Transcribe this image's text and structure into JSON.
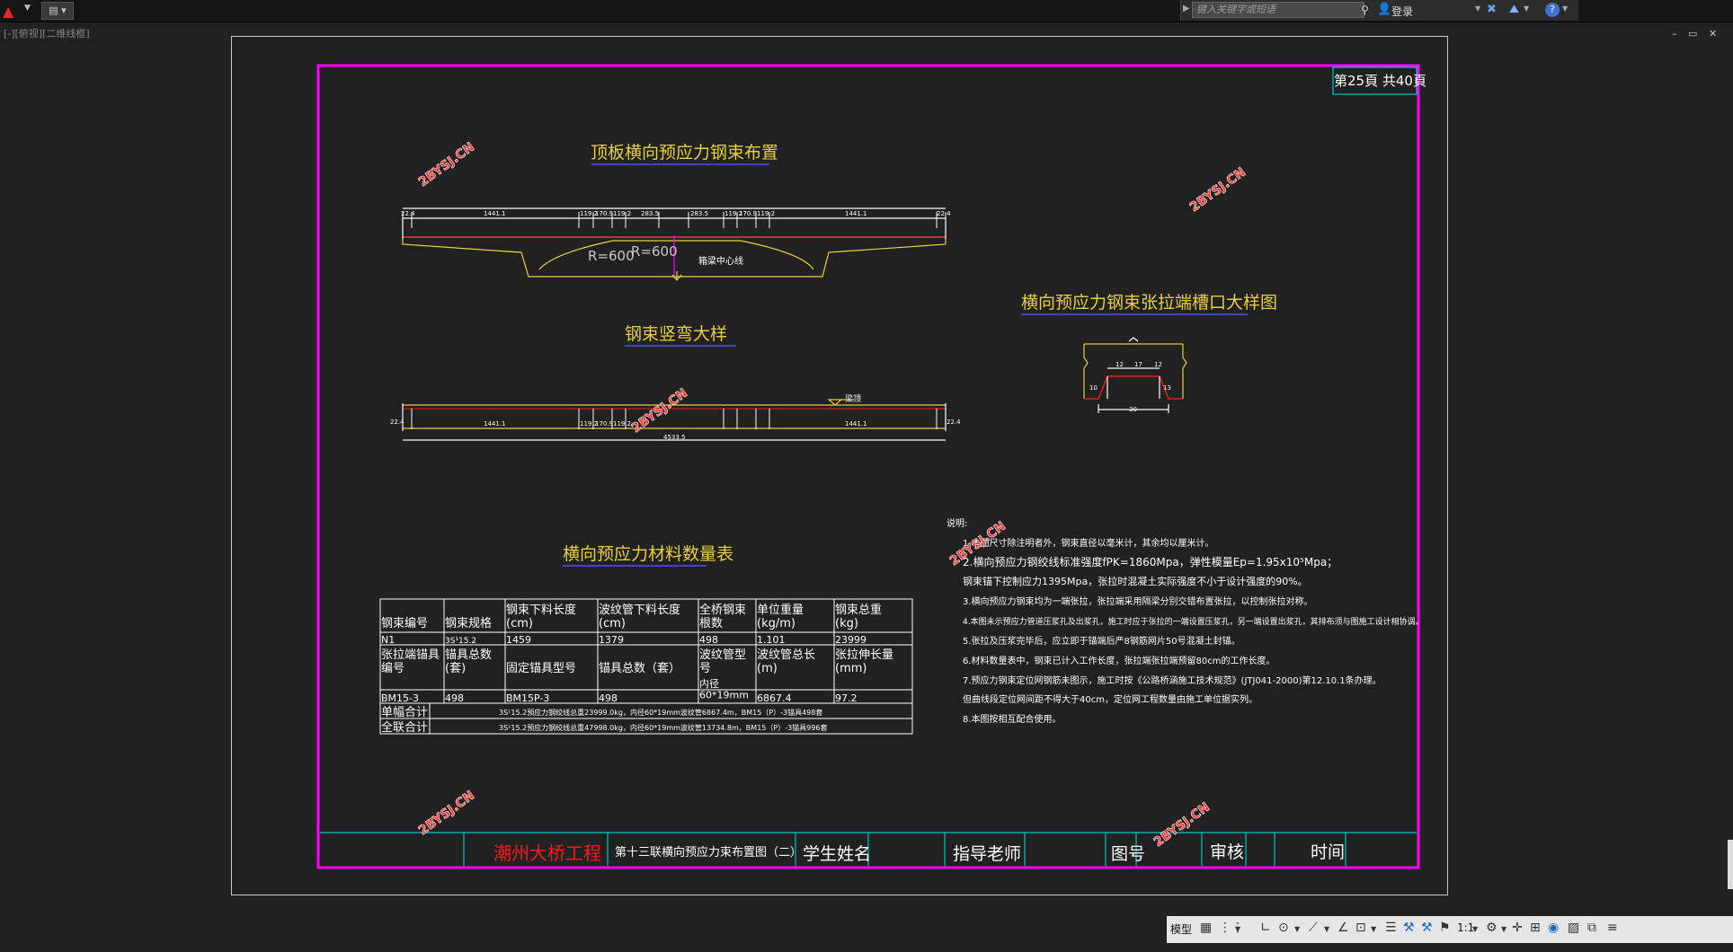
{
  "topbar": {
    "search_placeholder": "键入关键字或短语",
    "login_label": "登录",
    "help_glyph": "?"
  },
  "viewport_label": "[-][俯视][二维线框]",
  "window_controls": [
    "–",
    "▭",
    "✕"
  ],
  "drawing": {
    "page_info": "第25頁  共40頁",
    "watermark": "2BYSJ.CN",
    "title_deck": "顶板横向预应力钢束布置",
    "title_bend": "钢束竖弯大样",
    "title_slot": "横向预应力钢束张拉端槽口大样图",
    "title_table": "横向预应力材料数量表",
    "deck_dims": [
      "22.4",
      "1441.1",
      "119.2",
      "170.9",
      "119.2",
      "283.5",
      "283.5",
      "119.2",
      "170.9",
      "119.2",
      "1441.1",
      "22.4"
    ],
    "deck_radius_left": "R=600",
    "deck_radius_right": "R=600",
    "deck_centerline": "箱梁中心线",
    "bend_dims": [
      "22.4",
      "1441.1",
      "119.2",
      "170.9",
      "119.2",
      "1441.1",
      "22.4"
    ],
    "bend_total": "4533.5",
    "bend_top_label": "梁顶",
    "slot_dims": [
      "12",
      "17",
      "12",
      "10",
      "13",
      "30"
    ],
    "notes_title": "说明:",
    "notes": [
      "1.本图尺寸除注明者外，钢束直径以毫米计，其余均以厘米计。",
      "2.横向预应力钢绞线标准强度fPK=1860Mpa，弹性模量Ep=1.95x10⁵Mpa；",
      "   钢束锚下控制应力1395Mpa，张拉时混凝土实际强度不小于设计强度的90%。",
      "3.横向预应力钢束均为一端张拉，张拉端采用隔梁分别交错布置张拉，以控制张拉对称。",
      "4.本图未示预应力管道压浆孔及出浆孔，施工时应于张拉的一端设置压浆孔，另一端设置出浆孔，其排布须与图施工设计相协调。",
      "5.张拉及压浆完毕后，应立即于锚端后严8钢筋网片50号混凝土封锚。",
      "6.材料数量表中，钢束已计入工作长度，张拉端张拉端预留80cm的工作长度。",
      "7.预应力钢束定位网钢筋未图示，施工时按《公路桥涵施工技术规范》(JTJ041-2000)第12.10.1条办理。",
      "   但曲线段定位网间距不得大于40cm，定位网工程数量由施工单位据实列。",
      "8.本图按相互配合使用。"
    ],
    "table": {
      "header1": [
        "钢束编号",
        "钢束规格",
        "钢束下料长度\n(cm)",
        "波纹管下料长度\n(cm)",
        "全桥钢束\n根数",
        "单位重量\n(kg/m)",
        "钢束总重\n(kg)"
      ],
      "row1": [
        "N1",
        "3S¹15.2",
        "1459",
        "1379",
        "498",
        "1.101",
        "23999"
      ],
      "header2": [
        "张拉端锚具\n编号",
        "锚具总数\n(套)",
        "固定锚具型号",
        "锚具总数（套）",
        "波纹管型\n号",
        "波纹管总长\n(m)",
        "张拉伸长量\n(mm)"
      ],
      "row2": [
        "BM15-3",
        "498",
        "BM15P-3",
        "498",
        "内径\n60*19mm",
        "6867.4",
        "97.2"
      ],
      "sum_single_label": "单幅合计",
      "sum_single_text": "3S¹15.2预应力钢绞线总重23999.0kg，内径60*19mm波纹管6867.4m，BM15（P）-3锚具498套",
      "sum_full_label": "全联合计",
      "sum_full_text": "3S¹15.2预应力钢绞线总重47998.0kg，内径60*19mm波纹管13734.8m，BM15（P）-3锚具996套"
    },
    "titleblock": {
      "project": "潮州大桥工程",
      "drawing_name": "第十三联横向预应力束布置图（二）",
      "student": "学生姓名",
      "teacher": "指导老师",
      "drawing_no": "图号",
      "review": "审核",
      "time": "时间"
    }
  },
  "statusbar": {
    "model_label": "模型",
    "scale_label": "1:1"
  }
}
